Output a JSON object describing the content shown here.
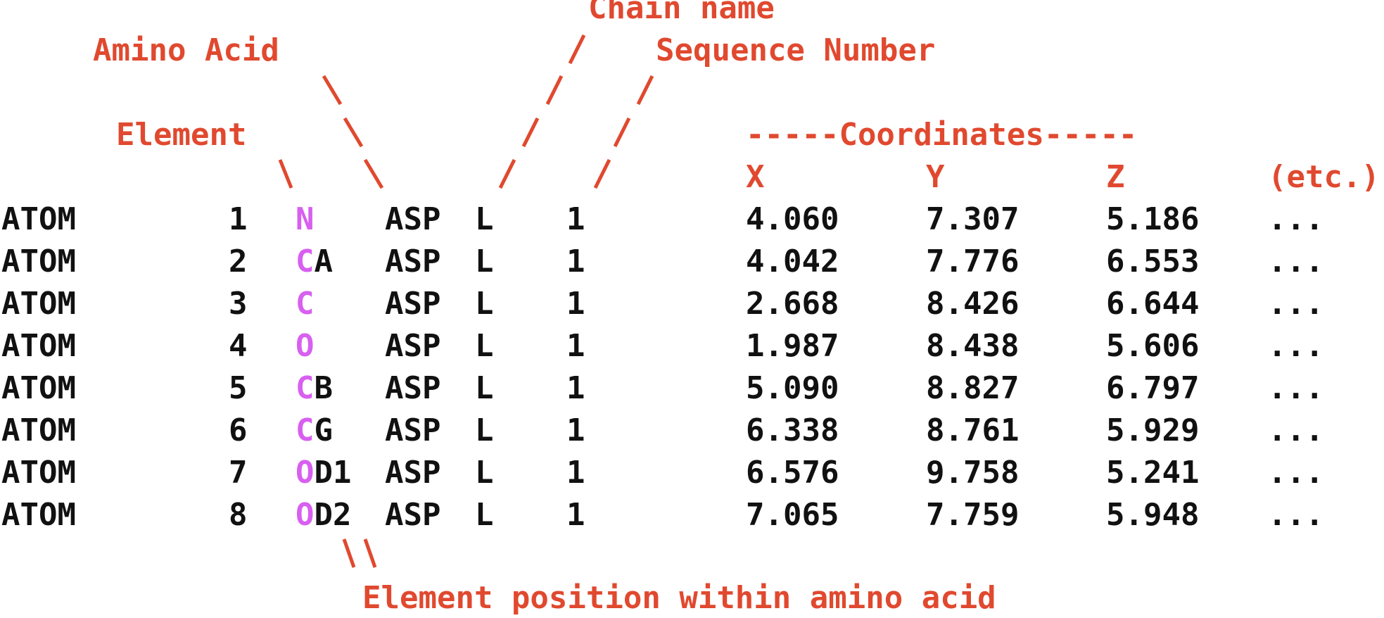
{
  "annotations": {
    "chain_name": "Chain name",
    "amino_acid": "Amino Acid",
    "sequence_number": "Sequence Number",
    "element": "Element",
    "coordinates": "-----Coordinates-----",
    "x": "X",
    "y": "Y",
    "z": "Z",
    "etc": "(etc.)",
    "element_position": "Element position within amino acid"
  },
  "colors": {
    "annotation": "#e0492f",
    "element_letter": "#d85ff0",
    "text": "#111111"
  },
  "rows": [
    {
      "record": "ATOM",
      "serial": "1",
      "element": "N",
      "position": "",
      "residue": "ASP",
      "chain": "L",
      "seq": "1",
      "x": "4.060",
      "y": "7.307",
      "z": "5.186",
      "more": "..."
    },
    {
      "record": "ATOM",
      "serial": "2",
      "element": "C",
      "position": "A",
      "residue": "ASP",
      "chain": "L",
      "seq": "1",
      "x": "4.042",
      "y": "7.776",
      "z": "6.553",
      "more": "..."
    },
    {
      "record": "ATOM",
      "serial": "3",
      "element": "C",
      "position": "",
      "residue": "ASP",
      "chain": "L",
      "seq": "1",
      "x": "2.668",
      "y": "8.426",
      "z": "6.644",
      "more": "..."
    },
    {
      "record": "ATOM",
      "serial": "4",
      "element": "O",
      "position": "",
      "residue": "ASP",
      "chain": "L",
      "seq": "1",
      "x": "1.987",
      "y": "8.438",
      "z": "5.606",
      "more": "..."
    },
    {
      "record": "ATOM",
      "serial": "5",
      "element": "C",
      "position": "B",
      "residue": "ASP",
      "chain": "L",
      "seq": "1",
      "x": "5.090",
      "y": "8.827",
      "z": "6.797",
      "more": "..."
    },
    {
      "record": "ATOM",
      "serial": "6",
      "element": "C",
      "position": "G",
      "residue": "ASP",
      "chain": "L",
      "seq": "1",
      "x": "6.338",
      "y": "8.761",
      "z": "5.929",
      "more": "..."
    },
    {
      "record": "ATOM",
      "serial": "7",
      "element": "O",
      "position": "D1",
      "residue": "ASP",
      "chain": "L",
      "seq": "1",
      "x": "6.576",
      "y": "9.758",
      "z": "5.241",
      "more": "..."
    },
    {
      "record": "ATOM",
      "serial": "8",
      "element": "O",
      "position": "D2",
      "residue": "ASP",
      "chain": "L",
      "seq": "1",
      "x": "7.065",
      "y": "7.759",
      "z": "5.948",
      "more": "..."
    }
  ]
}
